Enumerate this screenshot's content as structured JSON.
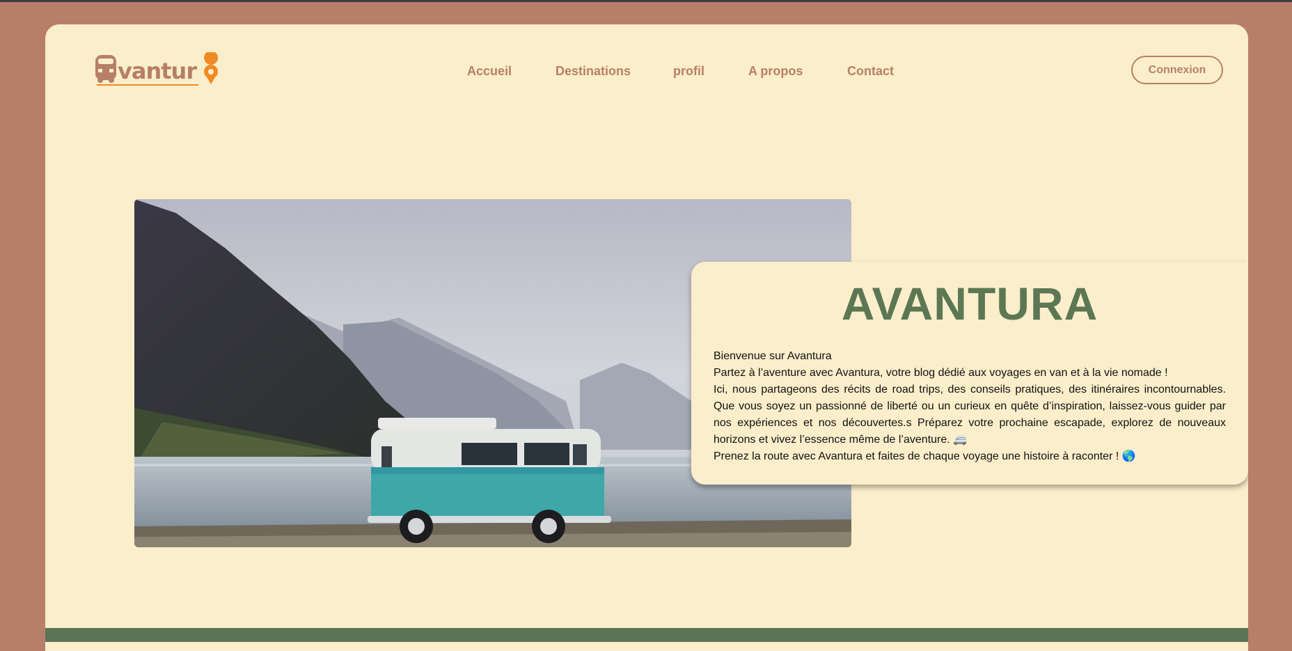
{
  "brand": {
    "logo_text": "Avantura",
    "colors": {
      "outer": "#b77f68",
      "page": "#fbeecb",
      "accent_green": "#5c7754",
      "logo_orange": "#ef8a24",
      "nav": "#b77f68"
    }
  },
  "nav": {
    "items": [
      {
        "label": "Accueil"
      },
      {
        "label": "Destinations"
      },
      {
        "label": "profil"
      },
      {
        "label": "A propos"
      },
      {
        "label": "Contact"
      }
    ],
    "login_label": "Connexion"
  },
  "hero": {
    "image_icon": "van-lake-mountains-photo",
    "card": {
      "title": "AVANTURA",
      "welcome": "Bienvenue sur Avantura",
      "line1": "Partez à l’aventure avec Avantura, votre blog dédié aux voyages en van et à la vie nomade !",
      "paragraph": "Ici, nous partageons des récits de road trips, des conseils pratiques, des itinéraires incontournables. Que vous soyez un passionné de liberté ou un curieux en quête d’inspiration, laissez-vous guider par nos expériences et nos découvertes.s Préparez votre prochaine escapade, explorez de nouveaux horizons et vivez l’essence même de l’aventure. 🚐",
      "closing": "Prenez la route avec Avantura et faites de chaque voyage une histoire à raconter ! 🌎"
    }
  }
}
